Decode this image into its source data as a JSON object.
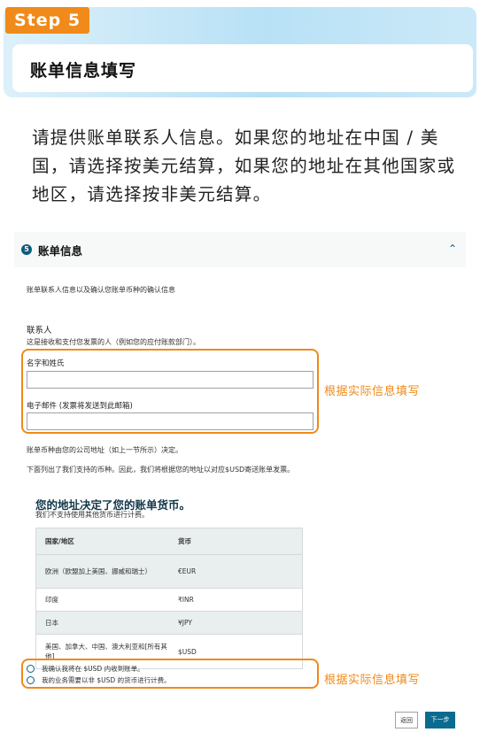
{
  "banner": {
    "step": "Step 5",
    "title": "账单信息填写"
  },
  "intro": "请提供账单联系人信息。如果您的地址在中国 / 美国，请选择按美元结算，如果您的地址在其他国家或地区，请选择按非美元结算。",
  "panel": {
    "step_number": "5",
    "title": "账单信息",
    "description": "账单联系人信息以及确认您账单币种的确认信息",
    "contact_label": "联系人",
    "contact_hint": "这是接收和支付您发票的人（例如您的应付账款部门）。",
    "name_label": "名字和姓氏",
    "name_value": "",
    "email_label": "电子邮件 (发票将发送到此邮箱)",
    "email_value": "",
    "currency_note_1": "账单币种由您的公司地址（如上一节所示）决定。",
    "currency_note_2": "下面列出了我们支持的币种。因此，我们将根据您的地址以对应$USD寄送账单发票。",
    "currency_title": "您的地址决定了您的账单货币。",
    "currency_sub": "我们不支持使用其他货币进行计费。",
    "table": {
      "headers": [
        "国家/地区",
        "货币"
      ],
      "rows": [
        [
          "欧洲（欧盟加上美国、挪威和瑞士）",
          "€EUR"
        ],
        [
          "印度",
          "₹INR"
        ],
        [
          "日本",
          "¥JPY"
        ],
        [
          "美国、加拿大、中国、澳大利亚和[所有其他]",
          "$USD"
        ]
      ]
    },
    "radio_1": "我确认我将在 $USD 内收到账单。",
    "radio_2": "我的业务需要以非 $USD 的货币进行计费。"
  },
  "annotations": {
    "note_1": "根据实际信息填写",
    "note_2": "根据实际信息填写"
  },
  "buttons": {
    "back": "返回",
    "next": "下一步"
  },
  "colors": {
    "accent_orange": "#f08a1a",
    "brand_blue": "#0b6b8f",
    "banner_light": "#cbe9f8"
  },
  "icons": {
    "chevron": "chevron-up-icon",
    "radio": "radio-icon"
  }
}
